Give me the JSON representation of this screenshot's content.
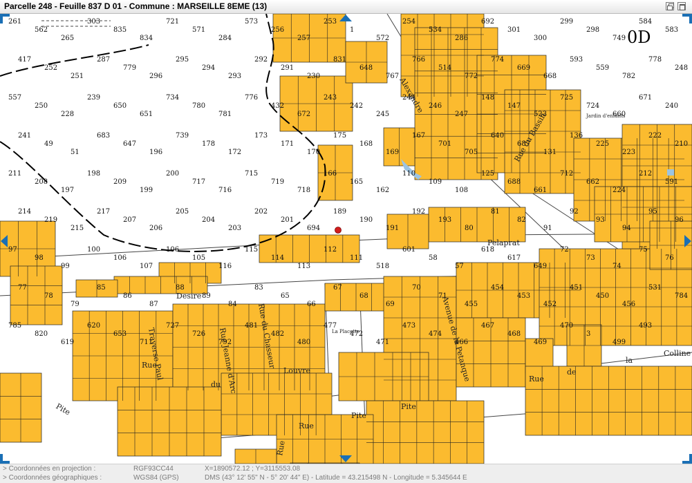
{
  "window": {
    "title": "Parcelle 248 - Feuille 837 D 01 - Commune : MARSEILLE 8EME (13)"
  },
  "map": {
    "section_label": "0D",
    "colors": {
      "parcel_fill": "#fbbb2f",
      "marker": "#d21e1e",
      "nav_arrow": "#1a6fb5",
      "water": "#9cc4e2"
    },
    "streets": [
      "Alexandre",
      "Rue du Bassin",
      "Pelaprat",
      "Desire",
      "Rue",
      "Rue Jeanne d'Arc",
      "Rue du Chasseur",
      "Louvre",
      "Avenue de la Petanque",
      "Traverse Paul",
      "du",
      "Rue",
      "de",
      "la",
      "Colline",
      "Pite",
      "Pite",
      "Pite",
      "Rue",
      "Rue",
      "La Placette",
      "Jardin d'enfants"
    ],
    "parcels": [
      "261",
      "562",
      "265",
      "303",
      "835",
      "834",
      "721",
      "571",
      "284",
      "573",
      "256",
      "257",
      "253",
      "1",
      "572",
      "254",
      "534",
      "286",
      "692",
      "301",
      "300",
      "299",
      "298",
      "749",
      "584",
      "583",
      "417",
      "252",
      "251",
      "287",
      "779",
      "296",
      "295",
      "294",
      "293",
      "292",
      "291",
      "230",
      "831",
      "648",
      "767",
      "766",
      "514",
      "772",
      "774",
      "669",
      "668",
      "593",
      "559",
      "782",
      "778",
      "248",
      "557",
      "250",
      "228",
      "239",
      "650",
      "651",
      "734",
      "780",
      "781",
      "776",
      "432",
      "672",
      "243",
      "242",
      "245",
      "244",
      "246",
      "247",
      "148",
      "147",
      "523",
      "725",
      "724",
      "660",
      "671",
      "240",
      "241",
      "49",
      "51",
      "683",
      "647",
      "196",
      "739",
      "178",
      "172",
      "173",
      "171",
      "170",
      "175",
      "168",
      "169",
      "167",
      "701",
      "705",
      "640",
      "687",
      "131",
      "136",
      "225",
      "223",
      "222",
      "210",
      "211",
      "208",
      "197",
      "198",
      "209",
      "199",
      "200",
      "717",
      "716",
      "715",
      "719",
      "718",
      "166",
      "165",
      "162",
      "110",
      "109",
      "108",
      "125",
      "688",
      "661",
      "712",
      "662",
      "224",
      "212",
      "591",
      "214",
      "219",
      "215",
      "217",
      "207",
      "206",
      "205",
      "204",
      "203",
      "202",
      "201",
      "694",
      "189",
      "190",
      "191",
      "192",
      "193",
      "80",
      "81",
      "82",
      "91",
      "92",
      "93",
      "94",
      "95",
      "96",
      "97",
      "98",
      "99",
      "100",
      "106",
      "107",
      "106",
      "105",
      "116",
      "115",
      "114",
      "113",
      "112",
      "111",
      "518",
      "601",
      "58",
      "57",
      "618",
      "617",
      "649",
      "72",
      "73",
      "74",
      "75",
      "76",
      "77",
      "78",
      "79",
      "85",
      "86",
      "87",
      "88",
      "89",
      "84",
      "83",
      "65",
      "66",
      "67",
      "68",
      "69",
      "70",
      "71",
      "455",
      "454",
      "453",
      "452",
      "451",
      "450",
      "456",
      "531",
      "784",
      "785",
      "820",
      "619",
      "620",
      "653",
      "711",
      "727",
      "726",
      "792",
      "481",
      "482",
      "480",
      "477",
      "472",
      "471",
      "473",
      "474",
      "466",
      "467",
      "468",
      "469",
      "470",
      "3",
      "499",
      "493"
    ]
  },
  "status": {
    "rows": [
      {
        "label": "> Coordonnées en projection :",
        "system": "RGF93CC44",
        "value": "X=1890572.12 ; Y=3115553.08"
      },
      {
        "label": "> Coordonnées géographiques :",
        "system": "WGS84 (GPS)",
        "value": "DMS (43° 12' 55\" N - 5° 20' 44\" E) - Latitude = 43.215498 N - Longitude = 5.345644 E"
      }
    ]
  }
}
